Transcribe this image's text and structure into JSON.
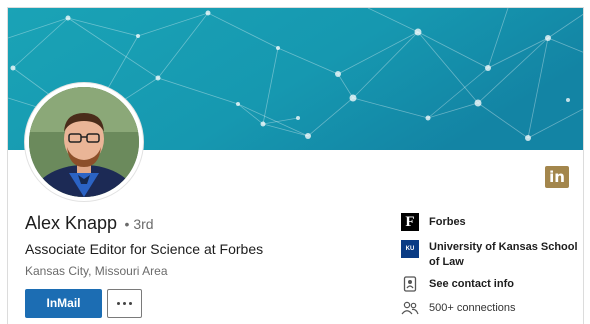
{
  "profile": {
    "name": "Alex Knapp",
    "degree": "• 3rd",
    "headline": "Associate Editor for Science at Forbes",
    "location": "Kansas City, Missouri Area"
  },
  "actions": {
    "inmail_label": "InMail",
    "more_icon": "ellipsis-icon"
  },
  "side": {
    "company": {
      "label": "Forbes",
      "icon": "forbes-logo-icon",
      "icon_text": "F"
    },
    "school": {
      "line1": "University of Kansas School",
      "line2": "of Law",
      "icon": "ku-logo-icon",
      "icon_text": "KU"
    },
    "contact": {
      "label": "See contact info",
      "icon": "contact-card-icon"
    },
    "connections": {
      "label": "500+ connections",
      "icon": "people-icon"
    }
  },
  "badge": {
    "text": "in",
    "icon": "linkedin-icon"
  },
  "colors": {
    "banner_start": "#1aa0b5",
    "banner_end": "#1287a6",
    "inmail": "#1c6db3",
    "linkedin_badge": "#a3864c"
  }
}
